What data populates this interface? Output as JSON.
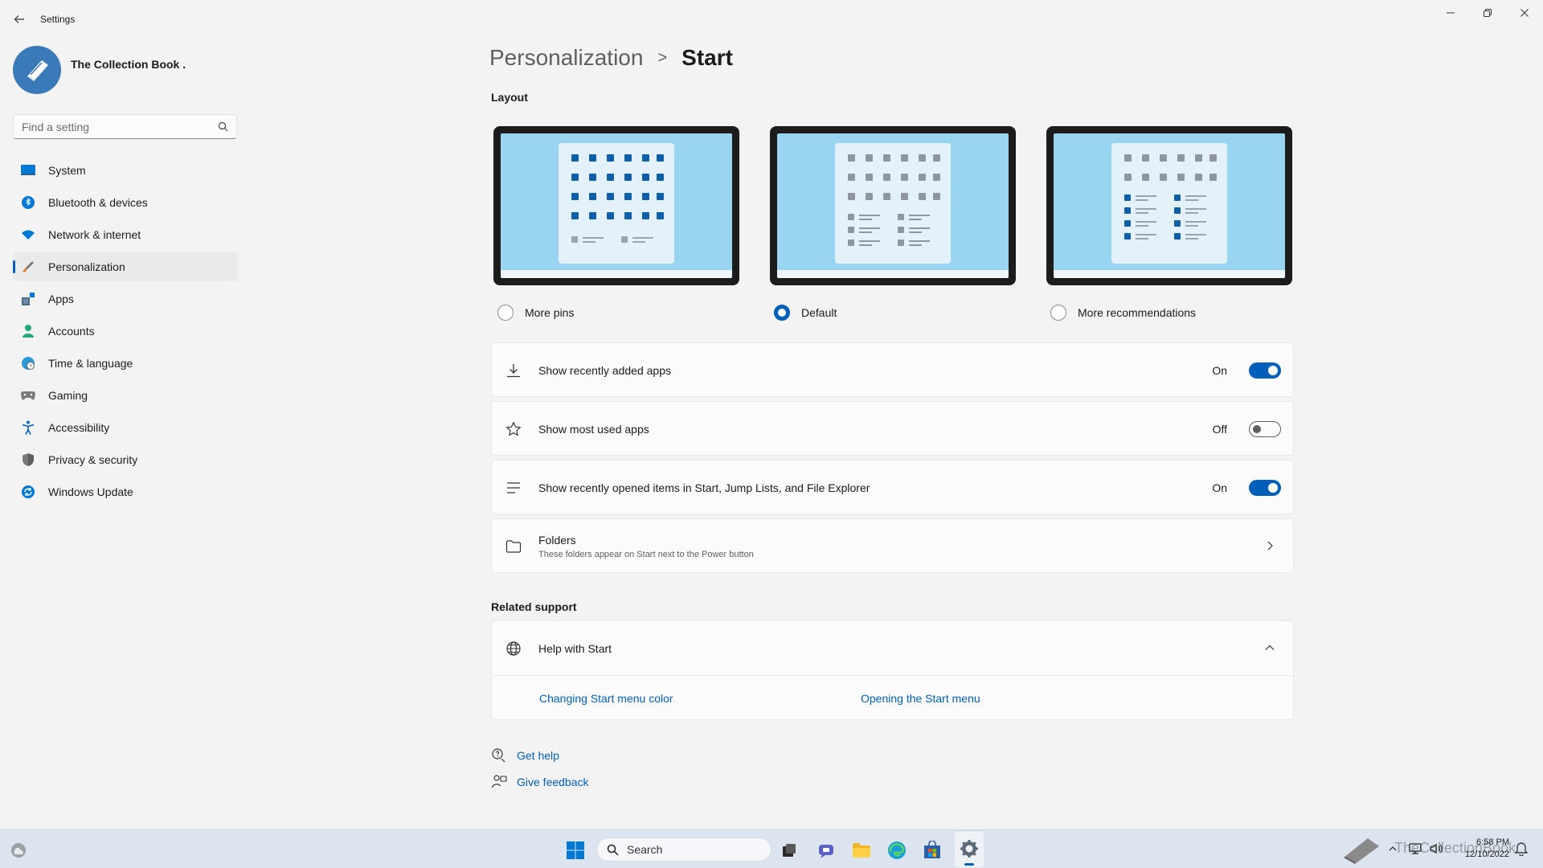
{
  "window": {
    "title": "Settings"
  },
  "profile": {
    "name": "The Collection Book ."
  },
  "search": {
    "placeholder": "Find a setting"
  },
  "sidebar": {
    "items": [
      {
        "label": "System",
        "icon": "system-icon"
      },
      {
        "label": "Bluetooth & devices",
        "icon": "bluetooth-icon"
      },
      {
        "label": "Network & internet",
        "icon": "wifi-icon"
      },
      {
        "label": "Personalization",
        "icon": "brush-icon",
        "active": true
      },
      {
        "label": "Apps",
        "icon": "apps-icon"
      },
      {
        "label": "Accounts",
        "icon": "accounts-icon"
      },
      {
        "label": "Time & language",
        "icon": "globe-clock-icon"
      },
      {
        "label": "Gaming",
        "icon": "gamepad-icon"
      },
      {
        "label": "Accessibility",
        "icon": "accessibility-icon"
      },
      {
        "label": "Privacy & security",
        "icon": "shield-icon"
      },
      {
        "label": "Windows Update",
        "icon": "update-icon"
      }
    ]
  },
  "breadcrumb": {
    "parent": "Personalization",
    "separator": ">",
    "current": "Start"
  },
  "layout": {
    "title": "Layout",
    "options": [
      {
        "label": "More pins",
        "selected": false
      },
      {
        "label": "Default",
        "selected": true
      },
      {
        "label": "More recommendations",
        "selected": false
      }
    ]
  },
  "settings": {
    "recently_added": {
      "label": "Show recently added apps",
      "state": "On"
    },
    "most_used": {
      "label": "Show most used apps",
      "state": "Off"
    },
    "recently_opened": {
      "label": "Show recently opened items in Start, Jump Lists, and File Explorer",
      "state": "On"
    },
    "folders": {
      "title": "Folders",
      "subtitle": "These folders appear on Start next to the Power button"
    }
  },
  "related": {
    "title": "Related support",
    "help_title": "Help with Start",
    "links": [
      "Changing Start menu color",
      "Opening the Start menu"
    ]
  },
  "footer": {
    "get_help": "Get help",
    "give_feedback": "Give feedback"
  },
  "taskbar": {
    "search_label": "Search",
    "time": "6:58 PM",
    "date": "12/10/2022",
    "watermark": "TheCollectionBook"
  },
  "colors": {
    "accent": "#005fb8",
    "background": "#f3f3f3",
    "card": "#fbfbfb"
  }
}
